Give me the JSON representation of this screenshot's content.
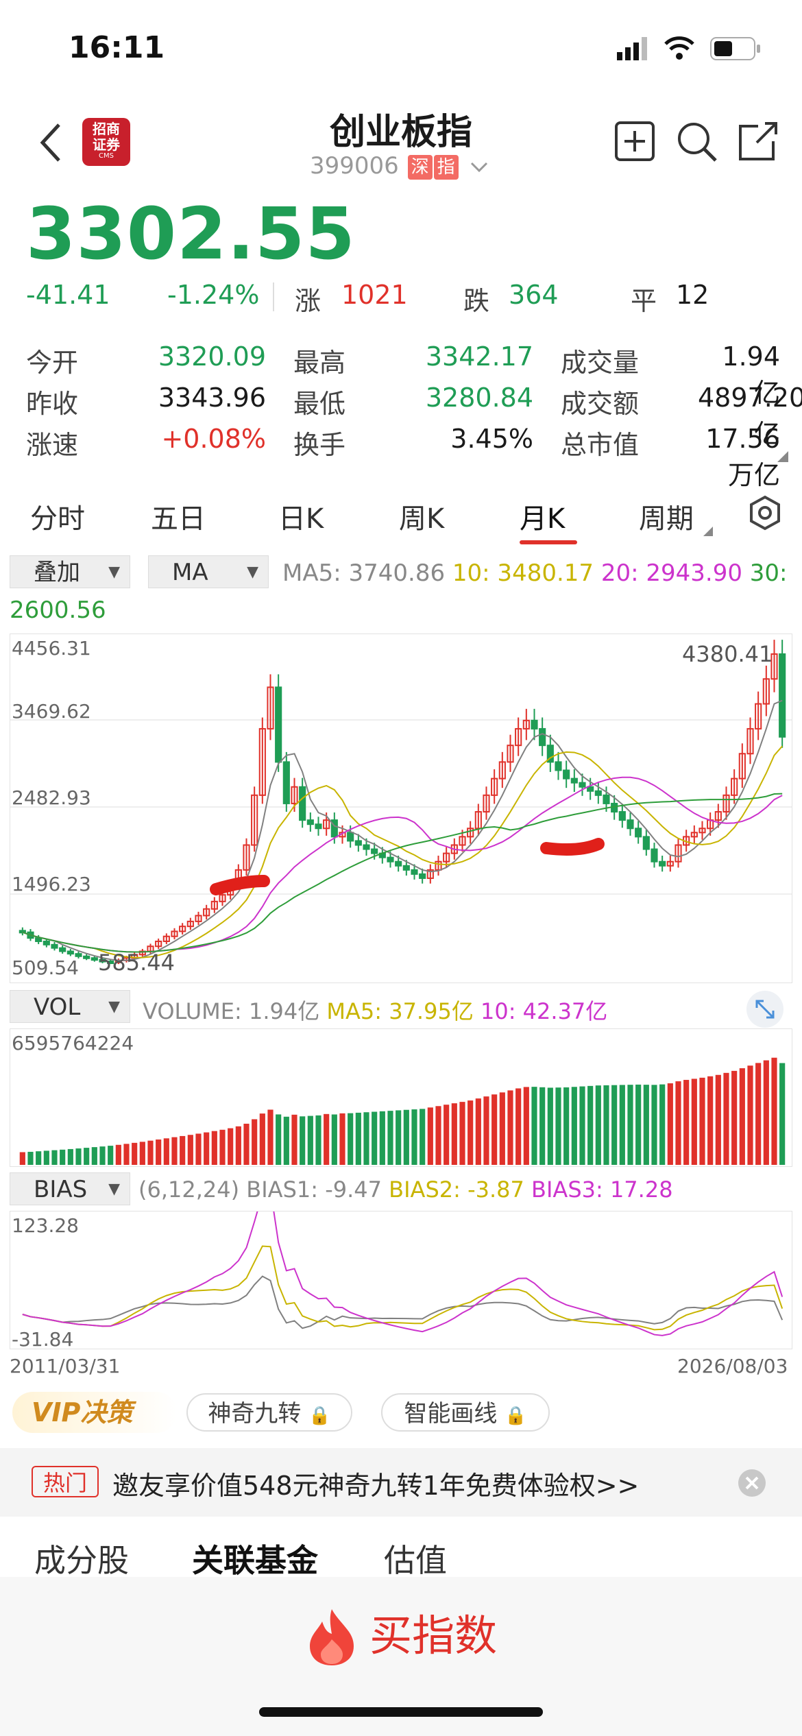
{
  "status_bar": {
    "time": "16:11"
  },
  "header": {
    "title": "创业板指",
    "code": "399006",
    "tag_market": "深",
    "tag_type": "指",
    "broker_logo_line1": "招商",
    "broker_logo_line2": "证券",
    "broker_logo_sub": "CMS"
  },
  "quote": {
    "price": "3302.55",
    "change": "-41.41",
    "change_pct": "-1.24%",
    "up_label": "涨",
    "up_count": "1021",
    "down_label": "跌",
    "down_count": "364",
    "flat_label": "平",
    "flat_count": "12"
  },
  "stats": [
    [
      {
        "label": "今开",
        "value": "3320.09",
        "tone": "green"
      },
      {
        "label": "最高",
        "value": "3342.17",
        "tone": "green"
      },
      {
        "label": "成交量",
        "value": "1.94亿",
        "tone": "dark"
      }
    ],
    [
      {
        "label": "昨收",
        "value": "3343.96",
        "tone": "dark"
      },
      {
        "label": "最低",
        "value": "3280.84",
        "tone": "green"
      },
      {
        "label": "成交额",
        "value": "4897.20亿",
        "tone": "dark"
      }
    ],
    [
      {
        "label": "涨速",
        "value": "+0.08%",
        "tone": "red"
      },
      {
        "label": "换手",
        "value": "3.45%",
        "tone": "dark"
      },
      {
        "label": "总市值",
        "value": "17.56万亿",
        "tone": "dark"
      }
    ]
  ],
  "tabs": [
    "分时",
    "五日",
    "日K",
    "周K",
    "月K",
    "周期"
  ],
  "active_tab": "月K",
  "indicators": {
    "overlay_select": "叠加",
    "ma_select": "MA",
    "ma5": "MA5: 3740.86",
    "ma10": "10: 3480.17",
    "ma20": "20: 2943.90",
    "ma30_label": "30:",
    "ma30_value": "2600.56",
    "vol_select": "VOL",
    "volume": "VOLUME: 1.94亿",
    "vol_ma5": "MA5: 37.95亿",
    "vol_ma10": "10: 42.37亿",
    "bias_select": "BIAS",
    "bias_params": "(6,12,24)",
    "bias1": "BIAS1: -9.47",
    "bias2": "BIAS2: -3.87",
    "bias3": "BIAS3: 17.28"
  },
  "chart_data": {
    "type": "candlestick",
    "x_start": "2011/03/31",
    "x_end": "2026/08/03",
    "y_ticks": [
      "4456.31",
      "3469.62",
      "2482.93",
      "1496.23",
      "509.54"
    ],
    "ylim": [
      509.54,
      4456.31
    ],
    "high_label": "4380.41",
    "low_label": "585.44",
    "closes": [
      950,
      880,
      840,
      800,
      760,
      720,
      690,
      660,
      640,
      620,
      600,
      590,
      610,
      640,
      680,
      720,
      780,
      840,
      900,
      960,
      1020,
      1080,
      1150,
      1230,
      1320,
      1400,
      1520,
      1700,
      2000,
      2600,
      3400,
      3900,
      3000,
      2500,
      2700,
      2300,
      2250,
      2200,
      2300,
      2100,
      2150,
      2050,
      2000,
      1950,
      1900,
      1850,
      1800,
      1750,
      1700,
      1650,
      1600,
      1700,
      1800,
      1900,
      2000,
      2100,
      2200,
      2400,
      2600,
      2800,
      3000,
      3200,
      3400,
      3500,
      3400,
      3200,
      3000,
      2900,
      2800,
      2750,
      2700,
      2650,
      2600,
      2500,
      2400,
      2300,
      2200,
      2100,
      1950,
      1800,
      1750,
      1800,
      2000,
      2100,
      2150,
      2200,
      2300,
      2400,
      2600,
      2800,
      3100,
      3400,
      3700,
      4000,
      4300,
      3302
    ],
    "volume_ticks": [
      "6595764224"
    ],
    "bias_ticks": [
      "123.28",
      "-31.84"
    ],
    "series_colors": {
      "up": "#e0312a",
      "down": "#1f9d55",
      "ma5": "#808080",
      "ma10": "#c8b400",
      "ma20": "#cc33cc",
      "ma30": "#2e9d3a"
    }
  },
  "tools": {
    "vip": "VIP决策",
    "tool1": "神奇九转",
    "tool2": "智能画线"
  },
  "banner": {
    "tag": "热门",
    "text": "邀友享价值548元神奇九转1年免费体验权>>"
  },
  "bottom_tabs": [
    "成分股",
    "关联基金",
    "估值"
  ],
  "buy_button": "买指数"
}
